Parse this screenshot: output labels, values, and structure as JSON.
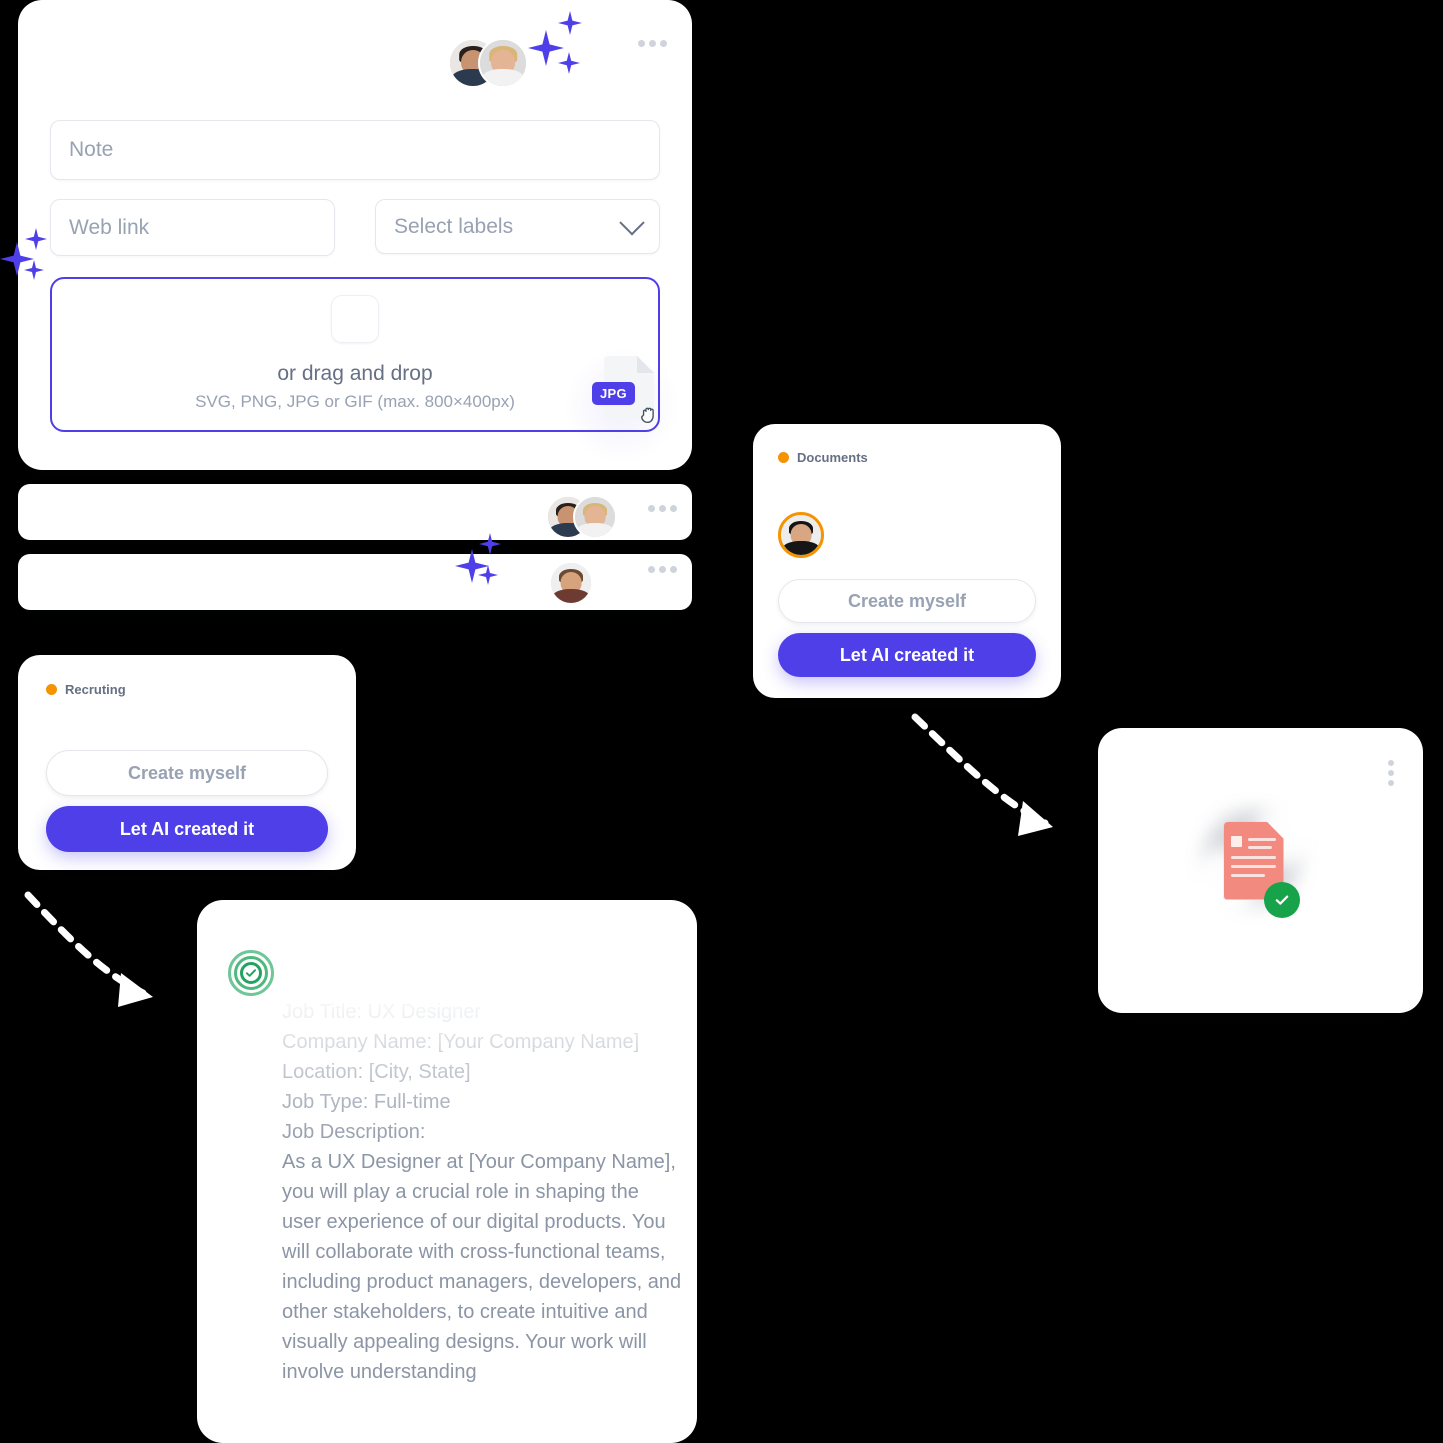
{
  "form_card": {
    "note_placeholder": "Note",
    "weblink_placeholder": "Web link",
    "labels_placeholder": "Select labels",
    "dropzone": {
      "drag_text": "or drag and drop",
      "formats_text": "SVG, PNG, JPG or GIF (max. 800×400px)",
      "file_badge": "JPG"
    }
  },
  "documents_card": {
    "status": "Documents",
    "create_label": "Create myself",
    "ai_label": "Let AI created it"
  },
  "recruiting_card": {
    "status": "Recruting",
    "create_label": "Create myself",
    "ai_label": "Let AI created it"
  },
  "jobdesc_card": {
    "text": "Job Title: UX Designer\nCompany Name: [Your Company Name]\nLocation: [City, State]\nJob Type: Full-time\nJob Description:\nAs a UX Designer at [Your Company Name], you will play a crucial role in shaping the user experience of our digital products. You will collaborate with cross-functional teams, including product managers, developers, and other stakeholders, to create intuitive and visually appealing designs. Your work will involve understanding"
  },
  "colors": {
    "primary": "#4F3FE8",
    "status_dot": "#F59300",
    "success_green": "#17A34A",
    "paper_red": "#F28A80",
    "text_muted": "#98A2B3",
    "border": "#E4E7EC"
  }
}
